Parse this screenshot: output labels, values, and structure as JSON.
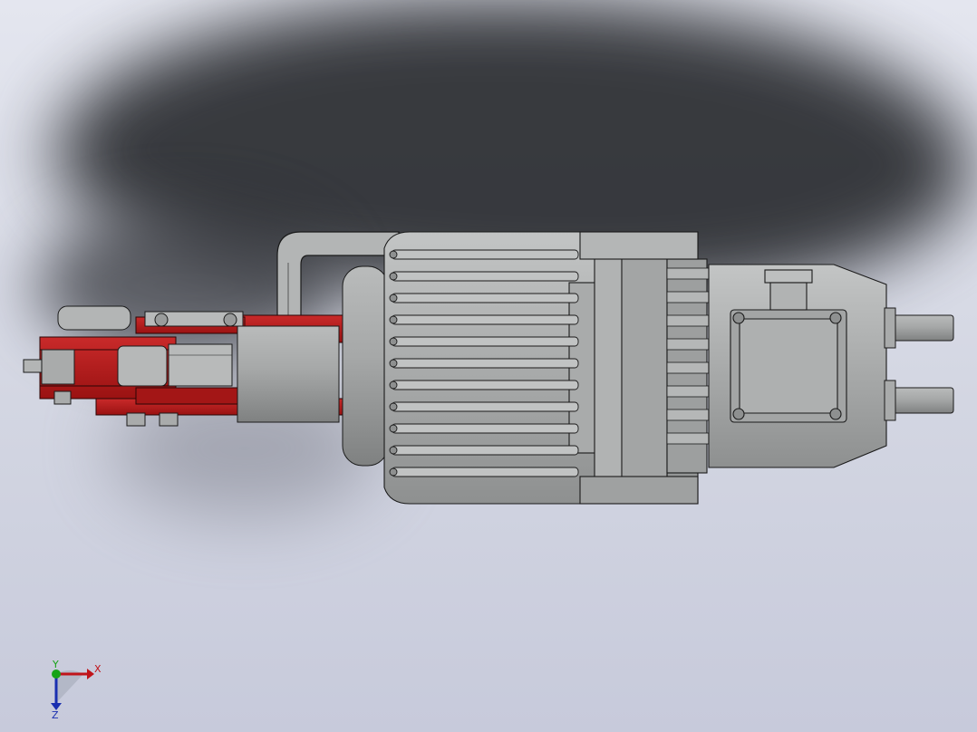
{
  "viewport": {
    "background": "#d3d6e2",
    "shadow_color": "#2a2c30"
  },
  "model": {
    "name": "electro-hydraulic-thruster",
    "parts": [
      "motor-housing",
      "cooling-fins",
      "terminal-box",
      "coupling-flange",
      "hydraulic-pipe",
      "red-clevis-bracket",
      "pin-end",
      "shaft-rods"
    ],
    "colors": {
      "housing": "#a9abab",
      "housing_dark": "#7e8080",
      "edges": "#1a1a1a",
      "bracket": "#b51a1a",
      "bracket_dark": "#7a0d0d"
    }
  },
  "triad": {
    "x_label": "X",
    "y_label": "Y",
    "z_label": "Z",
    "x_color": "#c0141a",
    "y_color": "#17a317",
    "z_color": "#1a2fb0"
  }
}
